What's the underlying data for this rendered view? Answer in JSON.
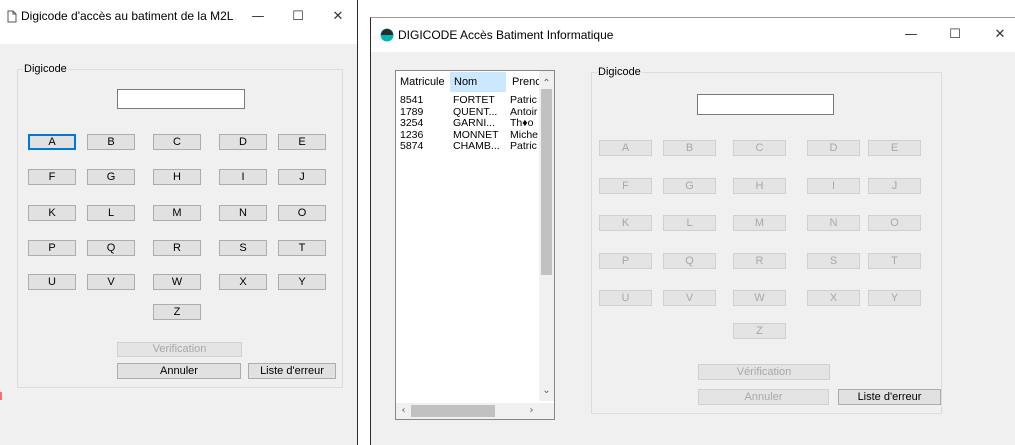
{
  "window1": {
    "title": "Digicode d'accès au batiment de la M2L",
    "app_icon": "document-icon",
    "group_label": "Digicode",
    "code_value": "",
    "letters": [
      "A",
      "B",
      "C",
      "D",
      "E",
      "F",
      "G",
      "H",
      "I",
      "J",
      "K",
      "L",
      "M",
      "N",
      "O",
      "P",
      "Q",
      "R",
      "S",
      "T",
      "U",
      "V",
      "W",
      "X",
      "Y",
      "Z"
    ],
    "verification_label": "Verification",
    "annuler_label": "Annuler",
    "liste_label": "Liste d'erreur"
  },
  "window2": {
    "title": "DIGICODE Accès Batiment Informatique",
    "app_icon": "app-circle-icon",
    "group_label": "Digicode",
    "code_value": "",
    "letters": [
      "A",
      "B",
      "C",
      "D",
      "E",
      "F",
      "G",
      "H",
      "I",
      "J",
      "K",
      "L",
      "M",
      "N",
      "O",
      "P",
      "Q",
      "R",
      "S",
      "T",
      "U",
      "V",
      "W",
      "X",
      "Y",
      "Z"
    ],
    "verification_label": "Vérification",
    "annuler_label": "Annuler",
    "liste_label": "Liste d'erreur",
    "list": {
      "columns": [
        "Matricule",
        "Nom",
        "Prenc"
      ],
      "rows": [
        [
          "8541",
          "FORTET",
          "Patric"
        ],
        [
          "1789",
          "QUENT...",
          "Antoir"
        ],
        [
          "3254",
          "GARNI...",
          "Th♦o"
        ],
        [
          "1236",
          "MONNET",
          "Miche"
        ],
        [
          "5874",
          "CHAMB...",
          "Patric"
        ]
      ]
    }
  },
  "window_controls": {
    "minimize": "—",
    "maximize": "☐",
    "close": "✕"
  },
  "colors": {
    "focus": "#0078d7",
    "column_header_selected": "#cce8ff",
    "window_bg": "#f0f0f0",
    "app_icon": "#00b4b0"
  }
}
